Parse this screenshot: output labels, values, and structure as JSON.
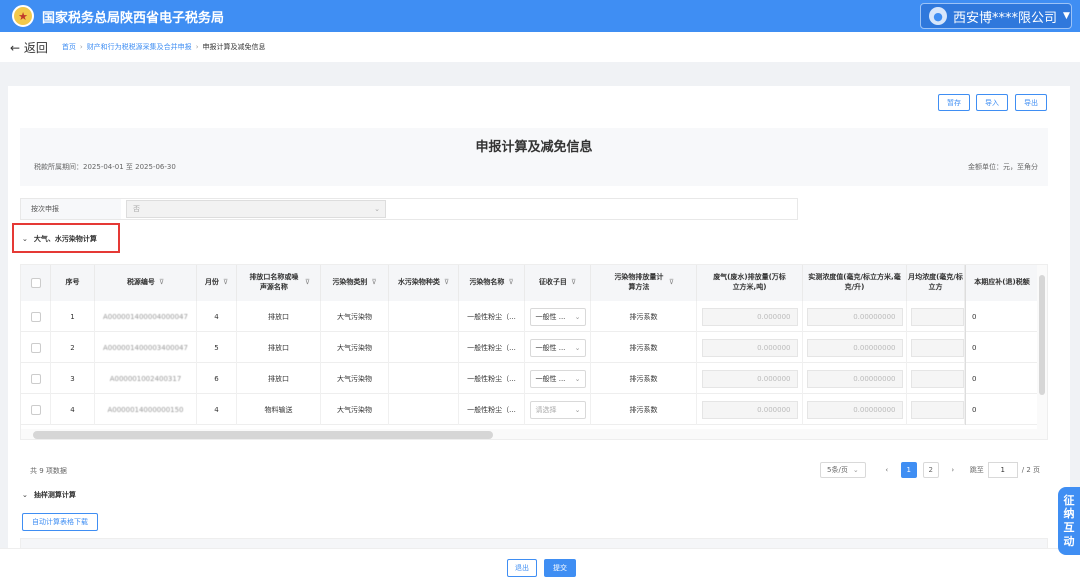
{
  "header": {
    "app_title": "国家税务总局陕西省电子税务局",
    "company": "西安博****限公司"
  },
  "nav": {
    "back": "← 返回",
    "breadcrumbs": [
      "首页",
      "财产和行为税税源采集及合并申报"
    ],
    "current": "申报计算及减免信息"
  },
  "toolbar": {
    "save": "暂存",
    "import": "导入",
    "export": "导出"
  },
  "form": {
    "title": "申报计算及减免信息",
    "period": "税款所属期间：2025-04-01 至 2025-06-30",
    "unit": "金额单位：元，至角分",
    "by_label": "按次申报",
    "by_value": "否"
  },
  "section1": {
    "title": "大气、水污染物计算"
  },
  "table": {
    "headers": [
      "序号",
      "税源编号",
      "月份",
      "排放口名称或噪声源名称",
      "污染物类别",
      "水污染物种类",
      "污染物名称",
      "征收子目",
      "污染物排放量计算方法",
      "废气(废水)排放量(万标立方米,吨)",
      "实测浓度值(毫克/标立方米,毫克/升)",
      "月均浓度(毫克/标立方",
      "本期应补(退)税额"
    ],
    "rows": [
      {
        "no": "1",
        "id": "A000001400004000047",
        "month": "4",
        "outlet": "排放口",
        "category": "大气污染物",
        "water_type": "",
        "name": "一般性粉尘（...",
        "item": "一般性 ...",
        "method": "排污系数",
        "volume": "0.000000",
        "conc": "0.00000000",
        "tax": "0"
      },
      {
        "no": "2",
        "id": "A000001400003400047",
        "month": "5",
        "outlet": "排放口",
        "category": "大气污染物",
        "water_type": "",
        "name": "一般性粉尘（...",
        "item": "一般性 ...",
        "method": "排污系数",
        "volume": "0.000000",
        "conc": "0.00000000",
        "tax": "0"
      },
      {
        "no": "3",
        "id": "A000001002400317",
        "month": "6",
        "outlet": "排放口",
        "category": "大气污染物",
        "water_type": "",
        "name": "一般性粉尘（...",
        "item": "一般性 ...",
        "method": "排污系数",
        "volume": "0.000000",
        "conc": "0.00000000",
        "tax": "0"
      },
      {
        "no": "4",
        "id": "A0000014000000150",
        "month": "4",
        "outlet": "物料输送",
        "category": "大气污染物",
        "water_type": "",
        "name": "一般性粉尘（...",
        "item": "请选择",
        "method": "排污系数",
        "volume": "0.000000",
        "conc": "0.00000000",
        "tax": "0"
      }
    ]
  },
  "pagination": {
    "total": "共 9 项数据",
    "page_size": "5条/页",
    "prev": "‹",
    "pages": [
      "1",
      "2"
    ],
    "next": "›",
    "goto_label": "跳至",
    "goto_value": "1",
    "page_total": "/ 2 页"
  },
  "section2": {
    "title": "抽样测算计算",
    "button": "自动计算表格下载"
  },
  "footer": {
    "exit": "退出",
    "submit": "提交"
  },
  "side_tab": {
    "text": [
      "征",
      "纳",
      "互",
      "动"
    ]
  },
  "colors": {
    "primary": "#3f8ef3",
    "highlight": "#e53935"
  }
}
